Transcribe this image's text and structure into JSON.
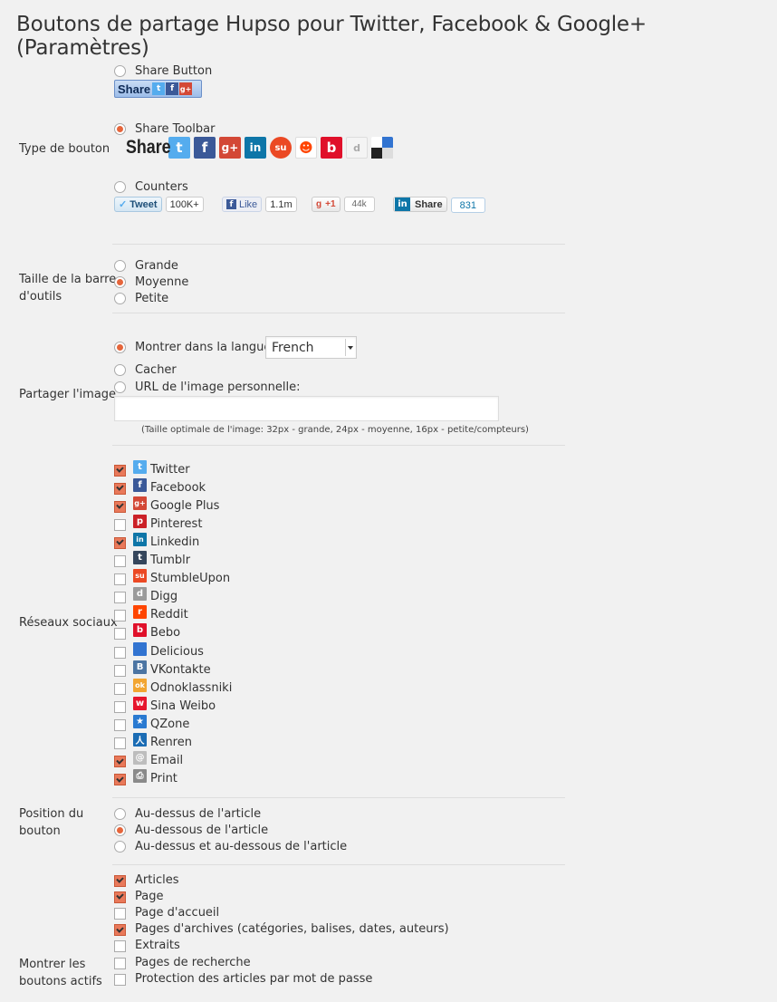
{
  "page_title": "Boutons de partage Hupso pour Twitter, Facebook & Google+ (Paramètres)",
  "button_type": {
    "label": "Type de bouton",
    "options": [
      {
        "label": "Share Button",
        "selected": false
      },
      {
        "label": "Share Toolbar",
        "selected": true
      },
      {
        "label": "Counters",
        "selected": false
      }
    ],
    "preview_share_text": "Share",
    "toolbar_share_text": "Share",
    "counters": {
      "tweet_label": "Tweet",
      "tweet_count": "100K+",
      "like_label": "Like",
      "like_count": "1.1m",
      "plusone_label": "+1",
      "plusone_count": "44k",
      "linkedin_label": "Share",
      "linkedin_count": "831"
    }
  },
  "toolbar_size": {
    "label_line1": "Taille de la barre",
    "label_line2": "d'outils",
    "options": [
      {
        "label": "Grande",
        "selected": false
      },
      {
        "label": "Moyenne",
        "selected": true
      },
      {
        "label": "Petite",
        "selected": false
      }
    ]
  },
  "share_image": {
    "label": "Partager l'image",
    "options": [
      {
        "label": "Montrer dans la langue:",
        "selected": true
      },
      {
        "label": "Cacher",
        "selected": false
      },
      {
        "label": "URL de l'image personnelle:",
        "selected": false
      }
    ],
    "language_value": "French",
    "url_value": "",
    "note": "(Taille optimale de l'image: 32px - grande, 24px - moyenne, 16px - petite/compteurs)"
  },
  "social_networks": {
    "label": "Réseaux sociaux",
    "items": [
      {
        "label": "Twitter",
        "checked": true,
        "icon": "twitter-icon",
        "color": "#55acee",
        "glyph": "t"
      },
      {
        "label": "Facebook",
        "checked": true,
        "icon": "facebook-icon",
        "color": "#3b5998",
        "glyph": "f"
      },
      {
        "label": "Google Plus",
        "checked": true,
        "icon": "google-plus-icon",
        "color": "#d34836",
        "glyph": "g+"
      },
      {
        "label": "Pinterest",
        "checked": false,
        "icon": "pinterest-icon",
        "color": "#cb2027",
        "glyph": "p"
      },
      {
        "label": "Linkedin",
        "checked": true,
        "icon": "linkedin-icon",
        "color": "#0e76a8",
        "glyph": "in"
      },
      {
        "label": "Tumblr",
        "checked": false,
        "icon": "tumblr-icon",
        "color": "#35465c",
        "glyph": "t"
      },
      {
        "label": "StumbleUpon",
        "checked": false,
        "icon": "stumbleupon-icon",
        "color": "#eb4924",
        "glyph": "su"
      },
      {
        "label": "Digg",
        "checked": false,
        "icon": "digg-icon",
        "color": "#9a9a9a",
        "glyph": "d"
      },
      {
        "label": "Reddit",
        "checked": false,
        "icon": "reddit-icon",
        "color": "#ff4500",
        "glyph": "r"
      },
      {
        "label": "Bebo",
        "checked": false,
        "icon": "bebo-icon",
        "color": "#e0102a",
        "glyph": "b"
      },
      {
        "label": "Delicious",
        "checked": false,
        "icon": "delicious-icon",
        "color": "#3274d1",
        "glyph": ""
      },
      {
        "label": "VKontakte",
        "checked": false,
        "icon": "vkontakte-icon",
        "color": "#4c75a3",
        "glyph": "B"
      },
      {
        "label": "Odnoklassniki",
        "checked": false,
        "icon": "odnoklassniki-icon",
        "color": "#f2a531",
        "glyph": "ok"
      },
      {
        "label": "Sina Weibo",
        "checked": false,
        "icon": "sina-weibo-icon",
        "color": "#e6162d",
        "glyph": "w"
      },
      {
        "label": "QZone",
        "checked": false,
        "icon": "qzone-icon",
        "color": "#2a7ad1",
        "glyph": "★"
      },
      {
        "label": "Renren",
        "checked": false,
        "icon": "renren-icon",
        "color": "#1b6cb4",
        "glyph": "人"
      },
      {
        "label": "Email",
        "checked": true,
        "icon": "email-icon",
        "color": "#bdbdbd",
        "glyph": "@"
      },
      {
        "label": "Print",
        "checked": true,
        "icon": "print-icon",
        "color": "#8a8a8a",
        "glyph": "⎙"
      }
    ]
  },
  "button_position": {
    "label_line1": "Position du",
    "label_line2": "bouton",
    "options": [
      {
        "label": "Au-dessus de l'article",
        "selected": false
      },
      {
        "label": "Au-dessous de l'article",
        "selected": true
      },
      {
        "label": "Au-dessus et au-dessous de l'article",
        "selected": false
      }
    ]
  },
  "show_buttons": {
    "label_line1": "Montrer les",
    "label_line2": "boutons actifs",
    "items": [
      {
        "label": "Articles",
        "checked": true
      },
      {
        "label": "Page",
        "checked": true
      },
      {
        "label": "Page d'accueil",
        "checked": false
      },
      {
        "label": "Pages d'archives (catégories, balises, dates, auteurs)",
        "checked": true
      },
      {
        "label": "Extraits",
        "checked": false
      },
      {
        "label": "Pages de recherche",
        "checked": false
      },
      {
        "label": "Protection des articles par mot de passe",
        "checked": false
      }
    ]
  },
  "colors": {
    "accent": "#e5653b",
    "checked_fill": "#e9795a",
    "background": "#f1f1f1"
  }
}
